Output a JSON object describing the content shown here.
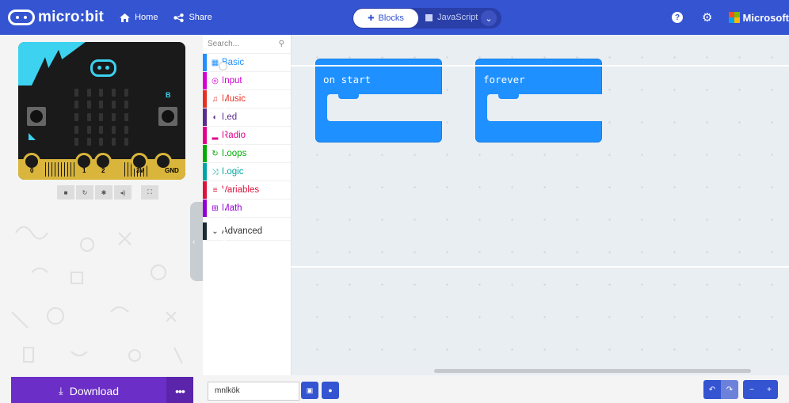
{
  "header": {
    "logo_text": "micro:bit",
    "home_label": "Home",
    "share_label": "Share",
    "blocks_tab": "Blocks",
    "javascript_tab": "JavaScript",
    "brand": "Microsoft",
    "accent_color": "#3454d1"
  },
  "simulator": {
    "pin_labels": [
      "0",
      "1",
      "2",
      "3V",
      "GND"
    ],
    "button_b_label": "B",
    "controls": [
      "stop",
      "restart",
      "debug",
      "mute",
      "fullscreen"
    ]
  },
  "toolbox": {
    "search_placeholder": "Search...",
    "categories": [
      {
        "label": "Basic",
        "color": "#1e90ff",
        "icon": "grid-icon"
      },
      {
        "label": "Input",
        "color": "#d400d4",
        "icon": "target-icon"
      },
      {
        "label": "Music",
        "color": "#e63022",
        "icon": "headphones-icon"
      },
      {
        "label": "Led",
        "color": "#5c2d91",
        "icon": "toggle-icon"
      },
      {
        "label": "Radio",
        "color": "#e3008c",
        "icon": "signal-icon"
      },
      {
        "label": "Loops",
        "color": "#00aa00",
        "icon": "refresh-icon"
      },
      {
        "label": "Logic",
        "color": "#00a4a6",
        "icon": "shuffle-icon"
      },
      {
        "label": "Variables",
        "color": "#dc143c",
        "icon": "lines-icon"
      },
      {
        "label": "Math",
        "color": "#9400d3",
        "icon": "calculator-icon"
      }
    ],
    "advanced_label": "Advanced"
  },
  "workspace": {
    "blocks": [
      {
        "title": "on start"
      },
      {
        "title": "forever"
      }
    ]
  },
  "footer": {
    "download_label": "Download",
    "more_label": "•••",
    "project_name": "mnlkök"
  }
}
